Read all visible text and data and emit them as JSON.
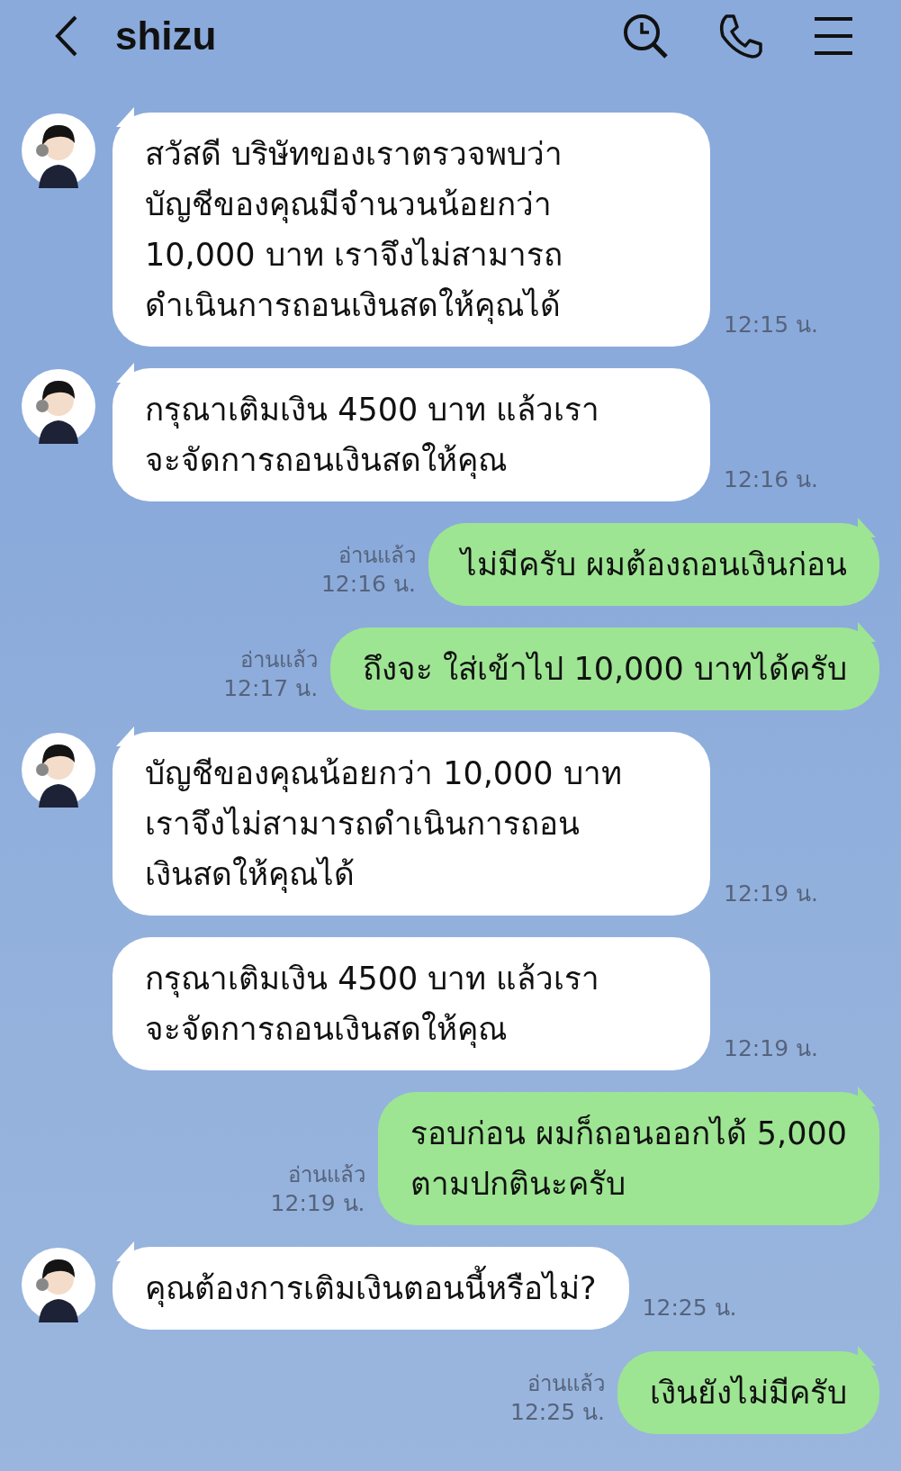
{
  "header": {
    "title": "shizu"
  },
  "messages": [
    {
      "kind": "in",
      "avatar": true,
      "text": "สวัสดี บริษัทของเราตรวจพบว่า\nบัญชีของคุณมีจำนวนน้อยกว่า\n10,000 บาท เราจึงไม่สามารถ\nดำเนินการถอนเงินสดให้คุณได้",
      "time": "12:15 น."
    },
    {
      "kind": "in",
      "avatar": true,
      "text": "กรุณาเติมเงิน 4500 บาท แล้วเรา\nจะจัดการถอนเงินสดให้คุณ",
      "time": "12:16 น."
    },
    {
      "kind": "out",
      "read": "อ่านแล้ว",
      "text": "ไม่มีครับ  ผมต้องถอนเงินก่อน",
      "time": "12:16 น."
    },
    {
      "kind": "out",
      "read": "อ่านแล้ว",
      "text": "ถึงจะ ใส่เข้าไป 10,000 บาทได้ครับ",
      "time": "12:17 น."
    },
    {
      "kind": "in",
      "avatar": true,
      "text": "บัญชีของคุณน้อยกว่า 10,000 บาท\nเราจึงไม่สามารถดำเนินการถอน\nเงินสดให้คุณได้",
      "time": "12:19 น."
    },
    {
      "kind": "in",
      "avatar": false,
      "text": "กรุณาเติมเงิน 4500 บาท แล้วเรา\nจะจัดการถอนเงินสดให้คุณ",
      "time": "12:19 น."
    },
    {
      "kind": "out",
      "read": "อ่านแล้ว",
      "text": "รอบก่อน ผมก็ถอนออกได้ 5,000\nตามปกตินะครับ",
      "time": "12:19 น."
    },
    {
      "kind": "in",
      "avatar": true,
      "text": "คุณต้องการเติมเงินตอนนี้หรือไม่?",
      "time": "12:25 น."
    },
    {
      "kind": "out",
      "read": "อ่านแล้ว",
      "text": "เงินยังไม่มีครับ",
      "time": "12:25 น."
    }
  ]
}
